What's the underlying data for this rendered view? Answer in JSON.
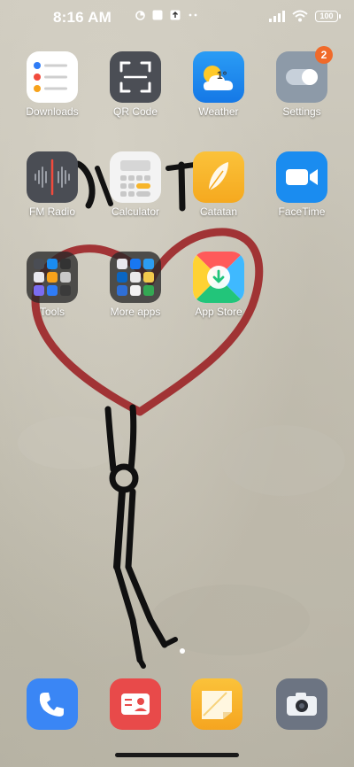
{
  "status_bar": {
    "time": "8:16 AM",
    "battery": "100"
  },
  "apps": [
    {
      "label": "Downloads"
    },
    {
      "label": "QR Code"
    },
    {
      "label": "Weather",
      "weather_temp": "1°"
    },
    {
      "label": "Settings",
      "badge": "2"
    },
    {
      "label": "FM Radio"
    },
    {
      "label": "Calculator"
    },
    {
      "label": "Catatan"
    },
    {
      "label": "FaceTime"
    },
    {
      "label": "Tools"
    },
    {
      "label": "More apps"
    },
    {
      "label": "App Store"
    }
  ],
  "dock": [
    {
      "icon": "phone-icon"
    },
    {
      "icon": "contacts-icon"
    },
    {
      "icon": "notes-icon"
    },
    {
      "icon": "camera-icon"
    }
  ],
  "colors": {
    "badge": "#f06a2a",
    "weather_blue": "#1e90f0",
    "catatan_yellow": "#f7b52a",
    "facetime_blue": "#1a8cf0",
    "phone_blue": "#3a86f5",
    "contacts_red": "#e84a4a",
    "notes_yellow": "#f7b731"
  }
}
